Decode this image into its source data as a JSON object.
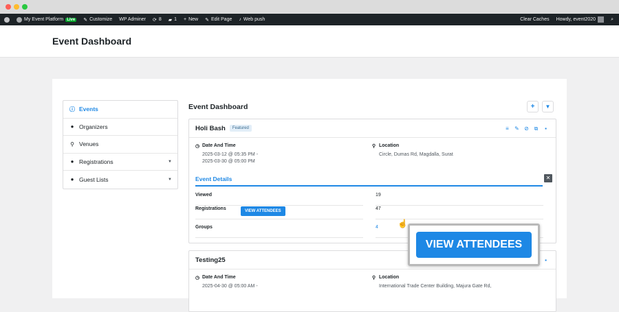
{
  "window": {
    "dot_colors": [
      "#ff5f57",
      "#febc2e",
      "#28c840"
    ]
  },
  "admin_bar": {
    "site_name": "My Event Platform",
    "live_badge": "Live",
    "customize": "Customize",
    "wp_adminer": "WP Adminer",
    "updates_count": "8",
    "comments_count": "1",
    "new": "New",
    "edit_page": "Edit Page",
    "web_push": "Web push",
    "clear_caches": "Clear Caches",
    "howdy": "Howdy, event2020"
  },
  "page": {
    "title": "Event Dashboard"
  },
  "sidebar": {
    "items": [
      {
        "label": "Events",
        "icon": "info-icon"
      },
      {
        "label": "Organizers",
        "icon": "user-icon"
      },
      {
        "label": "Venues",
        "icon": "map-pin-icon"
      },
      {
        "label": "Registrations",
        "icon": "users-icon"
      },
      {
        "label": "Guest Lists",
        "icon": "users-icon"
      }
    ]
  },
  "main": {
    "title": "Event Dashboard",
    "add_icon": "+",
    "filter_icon": "filter-icon"
  },
  "events": [
    {
      "title": "Holi Bash",
      "badge": "Featured",
      "date_label": "Date And Time",
      "date_line1": "2025-03-12 @ 05:35 PM -",
      "date_line2": "2025-03-30 @ 05:00 PM",
      "location_label": "Location",
      "location_value": "Circle, Dumas Rd, Magdalla, Surat",
      "details_title": "Event Details",
      "rows": [
        {
          "key": "Viewed",
          "value": "19"
        },
        {
          "key": "Registrations",
          "value": "47"
        },
        {
          "key": "Groups",
          "value": "4"
        }
      ],
      "view_attendees": "VIEW ATTENDEES"
    },
    {
      "title": "Testing25",
      "date_label": "Date And Time",
      "date_line1": "2025-04-30 @ 05:00 AM -",
      "location_label": "Location",
      "location_value": "International Trade Center Building, Majura Gate Rd,"
    }
  ],
  "zoom_callout": {
    "label": "VIEW ATTENDEES"
  },
  "colors": {
    "accent": "#1e88e5",
    "admin_bar": "#1d2327",
    "live": "#00a32a"
  }
}
